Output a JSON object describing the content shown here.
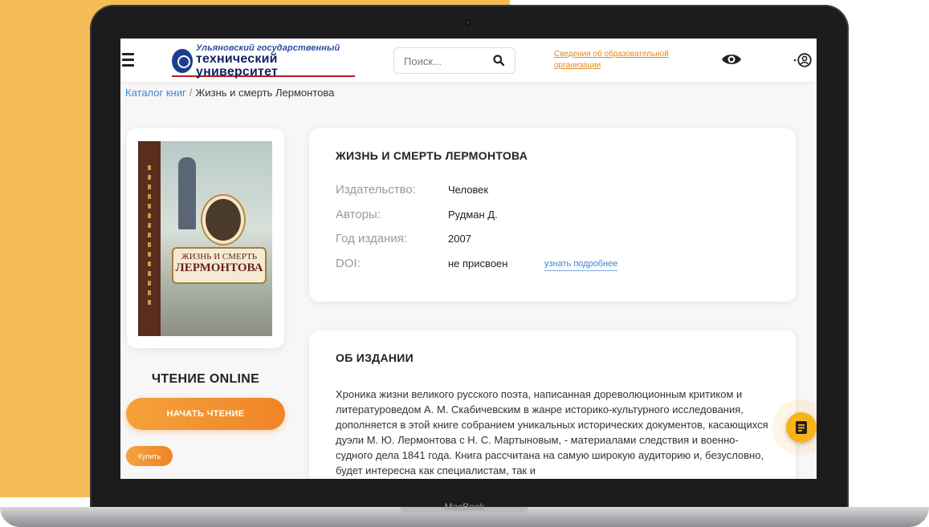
{
  "device": {
    "brand": "MacBook"
  },
  "header": {
    "logo_line1": "Ульяновский государственный",
    "logo_line2": "технический университет",
    "search_placeholder": "Поиск...",
    "org_link": "Сведения об образовательной организации"
  },
  "breadcrumb": {
    "parent": "Каталог книг",
    "separator": "/",
    "current": "Жизнь и смерть Лермонтова"
  },
  "cover": {
    "title_line1": "ЖИЗНЬ И СМЕРТЬ",
    "title_line2": "ЛЕРМОНТОВА"
  },
  "reading": {
    "title": "ЧТЕНИЕ ONLINE",
    "start_button": "НАЧАТЬ ЧТЕНИЕ",
    "buy_button": "Купить"
  },
  "book": {
    "title": "ЖИЗНЬ И СМЕРТЬ ЛЕРМОНТОВА",
    "fields": [
      {
        "label": "Издательство:",
        "value": "Человек"
      },
      {
        "label": "Авторы:",
        "value": "Рудман Д."
      },
      {
        "label": "Год издания:",
        "value": "2007"
      },
      {
        "label": "DOI:",
        "value": "не присвоен",
        "link": "узнать подробнее"
      }
    ]
  },
  "about": {
    "title": "ОБ ИЗДАНИИ",
    "text": "Хроника жизни великого русского поэта, написанная дореволюционным критиком и литературоведом А. М. Скабичевским в жанре историко-культурного исследования, дополняется в этой книге собранием уникальных исторических документов, касающихся дуэли М. Ю. Лермонтова с Н. С. Мартыновым, - материалами следствия и военно-судного дела 1841 года. Книга рассчитана на самую широкую аудиторию и, безусловно, будет интересна как специалистам, так и"
  },
  "colors": {
    "accent": "#f08426",
    "link": "#3d84d8",
    "background": "#f5bc57",
    "fab": "#f6b417"
  }
}
